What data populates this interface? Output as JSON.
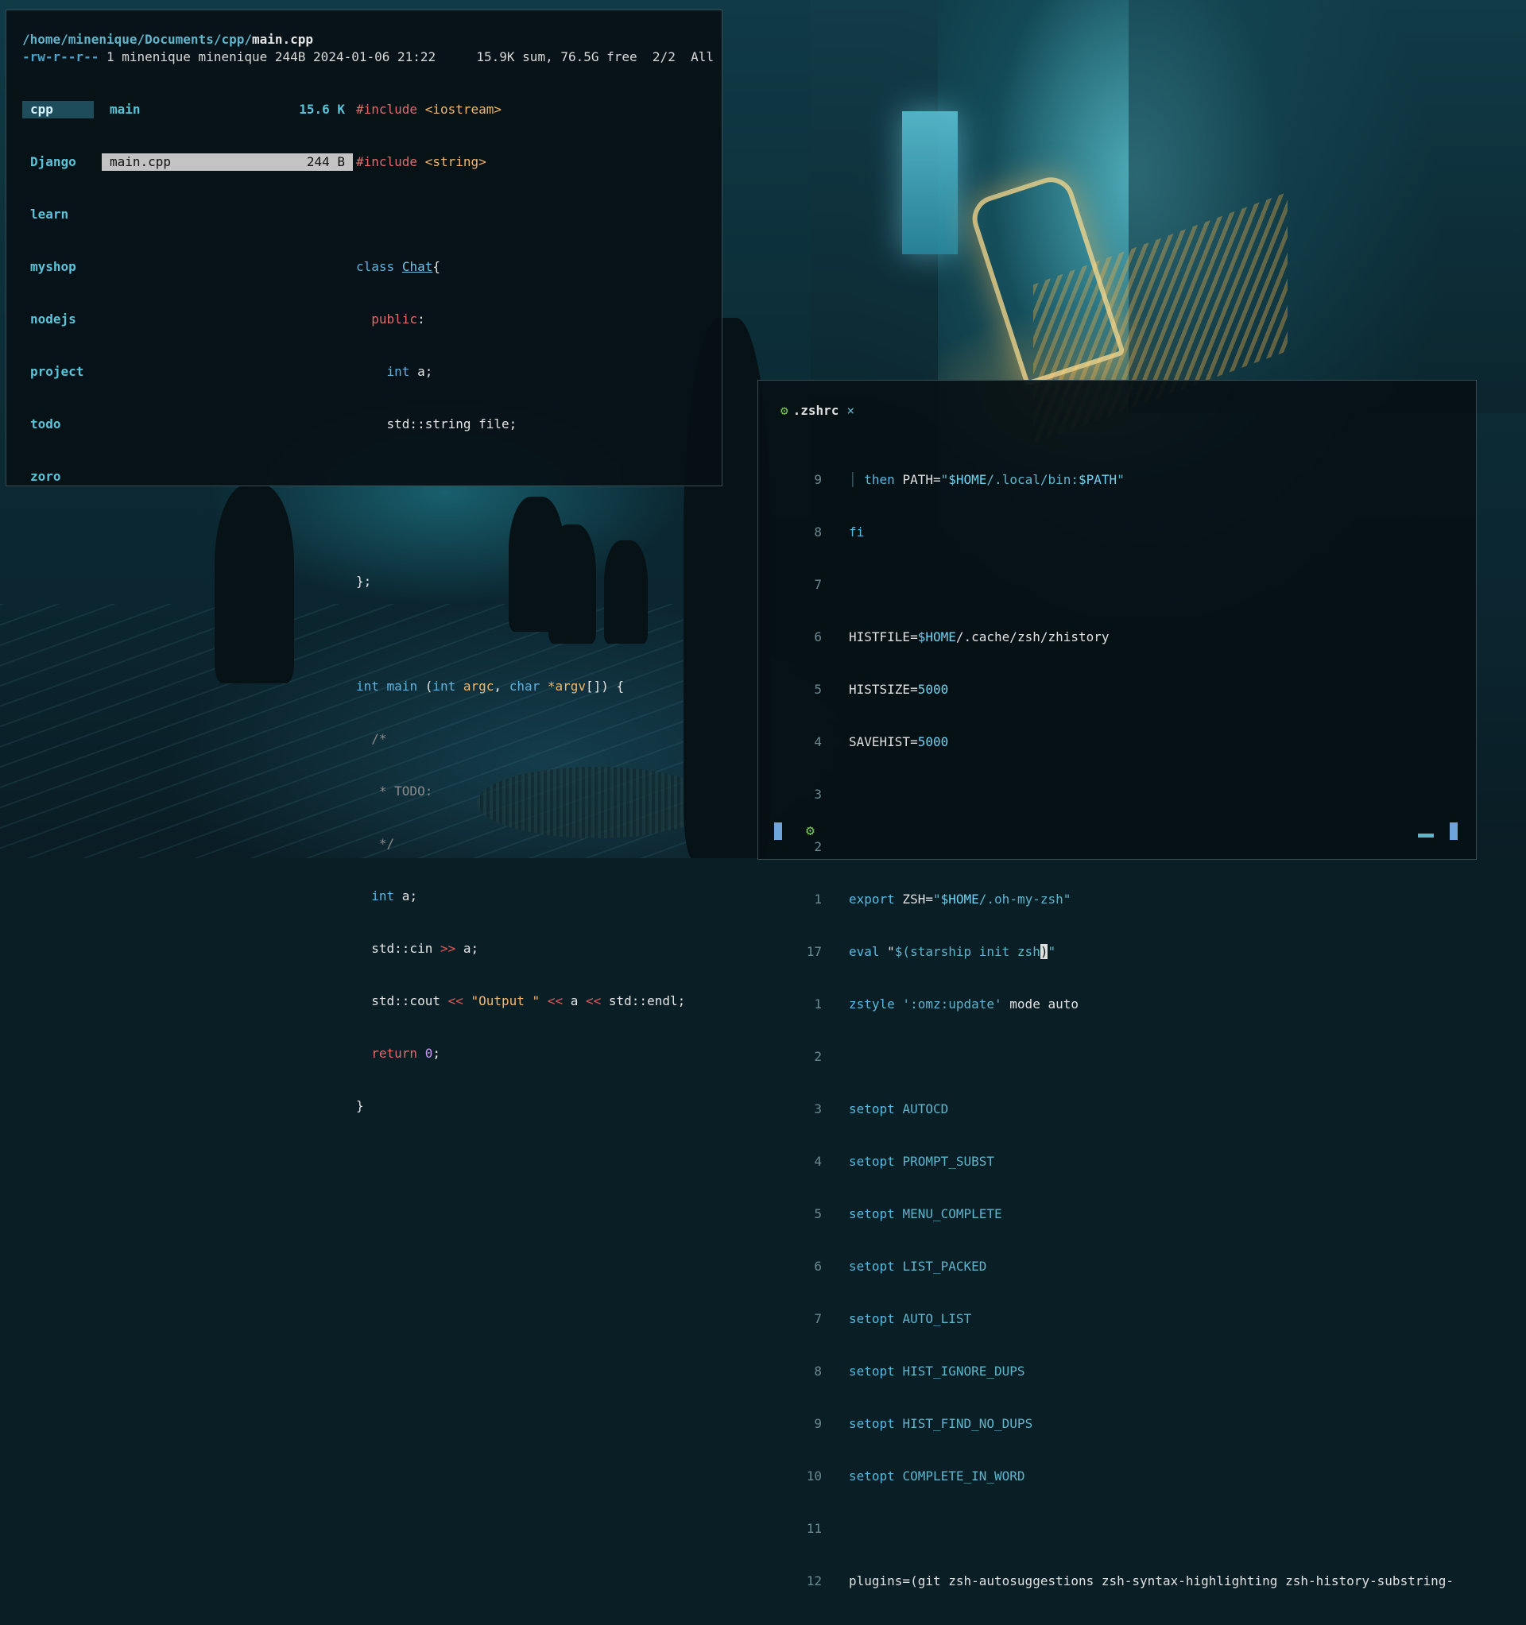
{
  "ranger": {
    "path_dir": "/home/minenique/Documents/cpp/",
    "path_file": "main.cpp",
    "permissions": "-rw-r--r--",
    "file_info": " 1 minenique minenique 244B 2024-01-06 21:22",
    "disk_info": "15.9K sum, 76.5G free  2/2  All",
    "parent_dirs": [
      "cpp",
      "Django",
      "learn",
      "myshop",
      "nodejs",
      "project",
      "todo",
      "zoro"
    ],
    "files": [
      {
        "name": "main",
        "size": "15.6 K"
      },
      {
        "name": "main.cpp",
        "size": "244 B"
      }
    ]
  },
  "preview": {
    "l1_pp": "#include",
    "l1_rest": " <iostream>",
    "l2_pp": "#include",
    "l2_rest": " <string>",
    "l4_kw": "class",
    "l4_cls": "Chat",
    "l4_rest": "{",
    "l5": "public",
    "l6_kw": "int",
    "l6_rest": " a;",
    "l7": "std::string file;",
    "l10": "};",
    "l12_kw1": "int",
    "l12_fn": " main ",
    "l12_p1": "(",
    "l12_kw2": "int",
    "l12_a1": " argc",
    "l12_c": ", ",
    "l12_kw3": "char",
    "l12_a2": " *argv",
    "l12_end": "[]) {",
    "l13": "/*",
    "l14": " * TODO:",
    "l15": " */",
    "l16_kw": "int",
    "l16_rest": " a;",
    "l17_a": "std::cin ",
    "l17_op": ">>",
    "l17_b": " a;",
    "l18_a": "std::cout ",
    "l18_op1": "<<",
    "l18_s": " \"Output \" ",
    "l18_op2": "<<",
    "l18_b": " a ",
    "l18_op3": "<<",
    "l18_c": " std::endl;",
    "l19_kw": "return",
    "l19_num": " 0",
    "l19_end": ";",
    "l20": "}"
  },
  "nvim": {
    "tab_name": ".zshrc",
    "tab_close": "×",
    "lines": [
      {
        "n": "9"
      },
      {
        "n": "8"
      },
      {
        "n": "7"
      },
      {
        "n": "6"
      },
      {
        "n": "5"
      },
      {
        "n": "4"
      },
      {
        "n": "3"
      },
      {
        "n": "2"
      },
      {
        "n": "1"
      },
      {
        "n": "17"
      },
      {
        "n": "1"
      },
      {
        "n": "2"
      },
      {
        "n": "3"
      },
      {
        "n": "4"
      },
      {
        "n": "5"
      },
      {
        "n": "6"
      },
      {
        "n": "7"
      },
      {
        "n": "8"
      },
      {
        "n": "9"
      },
      {
        "n": "10"
      },
      {
        "n": "11"
      },
      {
        "n": "12"
      }
    ],
    "code": {
      "c1_then": "then",
      "c1_path": " PATH=",
      "c1_q": "\"",
      "c1_home": "$HOME",
      "c1_mid": "/.local/bin:",
      "c1_p": "$PATH",
      "c1_q2": "\"",
      "c2": "fi",
      "c4_a": "HISTFILE=",
      "c4_home": "$HOME",
      "c4_b": "/.cache/zsh/zhistory",
      "c5_a": "HISTSIZE=",
      "c5_n": "5000",
      "c6_a": "SAVEHIST=",
      "c6_n": "5000",
      "c9_kw": "export",
      "c9_a": " ZSH=",
      "c9_q": "\"",
      "c9_home": "$HOME",
      "c9_b": "/.oh-my-zsh",
      "c9_q2": "\"",
      "c10_kw": "eval",
      "c10_a": " \"",
      "c10_b": "$(starship init zsh",
      "c10_cur": ")",
      "c10_q": "\"",
      "c11_kw": "zstyle",
      "c11_s": " ':omz:update'",
      "c11_b": " mode auto",
      "setopt": "setopt",
      "opts": [
        "AUTOCD",
        "PROMPT_SUBST",
        "MENU_COMPLETE",
        "LIST_PACKED",
        "AUTO_LIST",
        "HIST_IGNORE_DUPS",
        "HIST_FIND_NO_DUPS",
        "COMPLETE_IN_WORD"
      ],
      "c22": "plugins=(git zsh-autosuggestions zsh-syntax-highlighting zsh-history-substring-"
    }
  }
}
